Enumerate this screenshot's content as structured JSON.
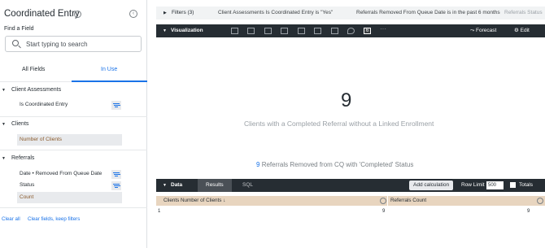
{
  "sidebar": {
    "title": "Coordinated Entry",
    "find_label": "Find a Field",
    "search_placeholder": "Start typing to search",
    "tabs": [
      {
        "label": "All Fields",
        "active": false
      },
      {
        "label": "In Use",
        "active": true
      }
    ],
    "groups": [
      {
        "label": "Client Assessments",
        "fields": [
          {
            "label": "Is Coordinated Entry",
            "selected": false,
            "filtered": true
          }
        ]
      },
      {
        "label": "Clients",
        "fields": [
          {
            "label": "Number of Clients",
            "selected": true,
            "filtered": false
          }
        ]
      },
      {
        "label": "Referrals",
        "fields": [
          {
            "label": "Date • Removed From Queue Date",
            "selected": false,
            "filtered": true
          },
          {
            "label": "Status",
            "selected": false,
            "filtered": true
          },
          {
            "label": "Count",
            "selected": true,
            "filtered": false
          }
        ]
      }
    ],
    "clear_all": "Clear all",
    "clear_fields": "Clear fields, keep filters"
  },
  "filters": {
    "label": "Filters (3)",
    "items": [
      "Client Assessments Is Coordinated Entry is \"Yes\"",
      "Referrals Removed From Queue Date is in the past 6 months",
      "Referrals Status"
    ]
  },
  "visualization": {
    "label": "Visualization",
    "active_icon": "6",
    "more": "···",
    "forecast": "Forecast",
    "edit": "Edit",
    "value": "9",
    "caption": "Clients with a Completed Referral without a Linked Enrollment",
    "comparison_value": "9",
    "comparison_text": "Referrals Removed from CQ with 'Completed' Status"
  },
  "data_panel": {
    "label": "Data",
    "tabs": [
      "Results",
      "SQL"
    ],
    "add_calculation": "Add calculation",
    "row_limit_label": "Row Limit",
    "row_limit_value": "500",
    "totals_label": "Totals",
    "columns": [
      "Clients Number of Clients ↓",
      "Referrals Count"
    ],
    "rows": [
      {
        "index": "1",
        "c1": "9",
        "c2": "9"
      }
    ]
  },
  "colors": {
    "accent": "#1a73e8",
    "dark_bar": "#262d33",
    "dimension_header": "#e8d5bf"
  }
}
